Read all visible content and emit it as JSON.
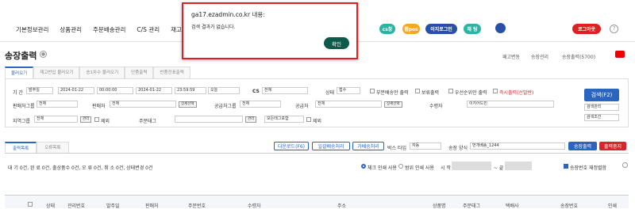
{
  "nav": {
    "menu": [
      "기본정보관리",
      "상품관리",
      "주문배송관리",
      "C/S 관리",
      "재고관"
    ],
    "pills": [
      {
        "label": "cs창",
        "color": "#2bb3a3"
      },
      {
        "label": "웹pos",
        "color": "#f5a623"
      },
      {
        "label": "이지로그인",
        "color": "#2a4fa8"
      },
      {
        "label": "채 팅",
        "color": "#2bb3a3"
      }
    ],
    "logout": "로그아웃",
    "help": "?"
  },
  "page": {
    "title": "송장출력",
    "breadcrumb": [
      "패고변동",
      "송장관리",
      "송장출력(5700)"
    ]
  },
  "top_tabs": [
    "불러오기",
    "재고반입 불러오기",
    "송1차수 불러오기",
    "단품출력",
    "반품전표출력"
  ],
  "filter": {
    "period_label": "기 간",
    "period_select": "발주일",
    "date_from": "2024-01-22",
    "time_from": "00:00:00",
    "date_to": "2024-01-22",
    "time_to": "23:59:59",
    "today": "오늘",
    "cs_label": "CS",
    "cs_value": "전체",
    "status_label": "상태",
    "status_value": "접수",
    "checks": [
      "부분배송만 출력",
      "보류출력",
      "우선순위만 출력",
      "즉시출력(선발반)"
    ],
    "seller_group_label": "판매처그룹",
    "seller_group_value": "전체",
    "seller_label": "판매처",
    "seller_value": "전체",
    "seller_select_btn": "상세선택",
    "supplier_group_label": "공급처그룹",
    "supplier_group_value": "전체",
    "supplier_label": "공급처",
    "supplier_value": "전체",
    "supplier_select_btn": "상세선택",
    "receiver_label": "수령자",
    "receiver_value": "이지어드민",
    "region_label": "지역그룹",
    "region_value": "전체",
    "manage_btn": "관리",
    "exclude": "제외",
    "order_tag_label": "주문태그",
    "manage_btn2": "관리",
    "tag_value": "모든태그포함",
    "exclude2": "제외",
    "search_btn": "검색(F2)",
    "search_manage": "검색관리",
    "search_cond": "검색조건"
  },
  "result_tabs": [
    "출력목록",
    "오류목록"
  ],
  "actions": {
    "download": "다운로드(F6)",
    "bulk": "일괄배송처리",
    "delivery": "가배송처리",
    "box_label": "박스 타입",
    "box_value": "자동",
    "ship_label": "송장 양식",
    "ship_value": "번개배송_1244",
    "print": "송장출력",
    "stop": "출력중지"
  },
  "counts": "대 기 0건, 완 료 0건, 출상품수 0건, 오 류 0건, 취 소 0건, 상태변경 0건",
  "print_opts": {
    "check": "체크 인쇄 사용",
    "range": "범위 인쇄 사용",
    "start": "시 작",
    "end": "~ 끝",
    "resort": "송장번호 재정렬함"
  },
  "columns": [
    "상태",
    "관리번호",
    "발주일",
    "판매처",
    "주문번호",
    "수령자",
    "주소",
    "상품명",
    "주문태그",
    "택배사",
    "송장번호",
    "인쇄"
  ],
  "dialog": {
    "title": "ga17.ezadmin.co.kr 내용:",
    "message": "검색 결과가 없습니다.",
    "ok": "확인"
  },
  "colors": {
    "accent": "#2a65c0",
    "danger": "#d9232d",
    "ok_button": "#0c5a4a"
  }
}
